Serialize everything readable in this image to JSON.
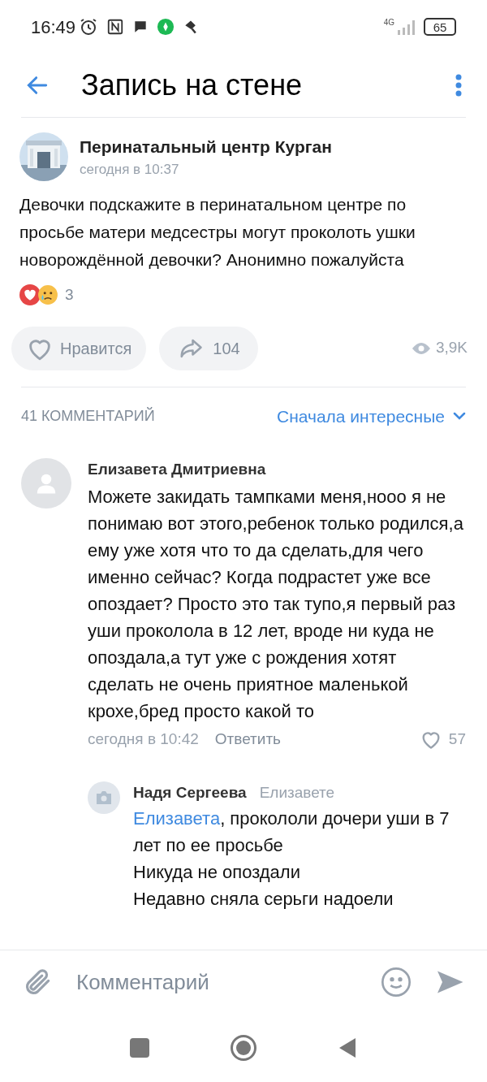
{
  "status_bar": {
    "time": "16:49",
    "network": "4G",
    "battery": "65"
  },
  "header": {
    "title": "Запись на стене"
  },
  "post": {
    "author": "Перинатальный центр Курган",
    "time": "сегодня в 10:37",
    "text": "Девочки подскажите в перинатальном центре по просьбе матери медсестры могут проколоть ушки новорождённой девочки? Анонимно пожалуйста",
    "reactions_count": "3",
    "like_label": "Нравится",
    "liked": false,
    "shares": "104",
    "views": "3,9K"
  },
  "comments_header": {
    "count": "41 КОММЕНТАРИЙ",
    "sort": "Сначала интересные"
  },
  "comments": [
    {
      "author": "Елизавета Дмитриевна",
      "text": "Можете закидать тампками меня,нооо я не понимаю вот этого,ребенок только родился,а ему уже хотя что то да сделать,для чего именно сейчас? Когда подрастет уже все опоздает? Просто это так тупо,я первый раз уши проколола в 12 лет, вроде ни куда не опоздала,а тут уже с рождения хотят сделать не очень приятное маленькой крохе,бред просто какой то",
      "time": "сегодня в 10:42",
      "reply_label": "Ответить",
      "likes": "57",
      "liked": false,
      "replies": [
        {
          "author": "Надя Сергеева",
          "reply_to": "Елизавете",
          "mention": "Елизавета",
          "lines": [
            ", прокололи дочери уши в 7 лет по ее просьбе",
            "Никуда не опоздали",
            "Недавно сняла серьги надоели"
          ]
        }
      ]
    }
  ],
  "composer": {
    "placeholder": "Комментарий"
  }
}
